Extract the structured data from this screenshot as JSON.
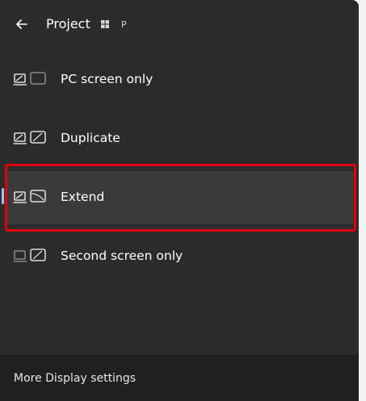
{
  "header": {
    "title": "Project",
    "shortcut_key": "P"
  },
  "options": [
    {
      "label": "PC screen only",
      "icon": "pc-screen-only-icon"
    },
    {
      "label": "Duplicate",
      "icon": "duplicate-icon"
    },
    {
      "label": "Extend",
      "icon": "extend-icon",
      "selected": true
    },
    {
      "label": "Second screen only",
      "icon": "second-screen-only-icon"
    }
  ],
  "footer": {
    "link": "More Display settings"
  },
  "colors": {
    "panel_bg": "#2b2b2b",
    "selected_bg": "#3a3a3a",
    "highlight": "#e00012",
    "indicator": "#a0c3ff",
    "footer_bg": "#202020"
  }
}
